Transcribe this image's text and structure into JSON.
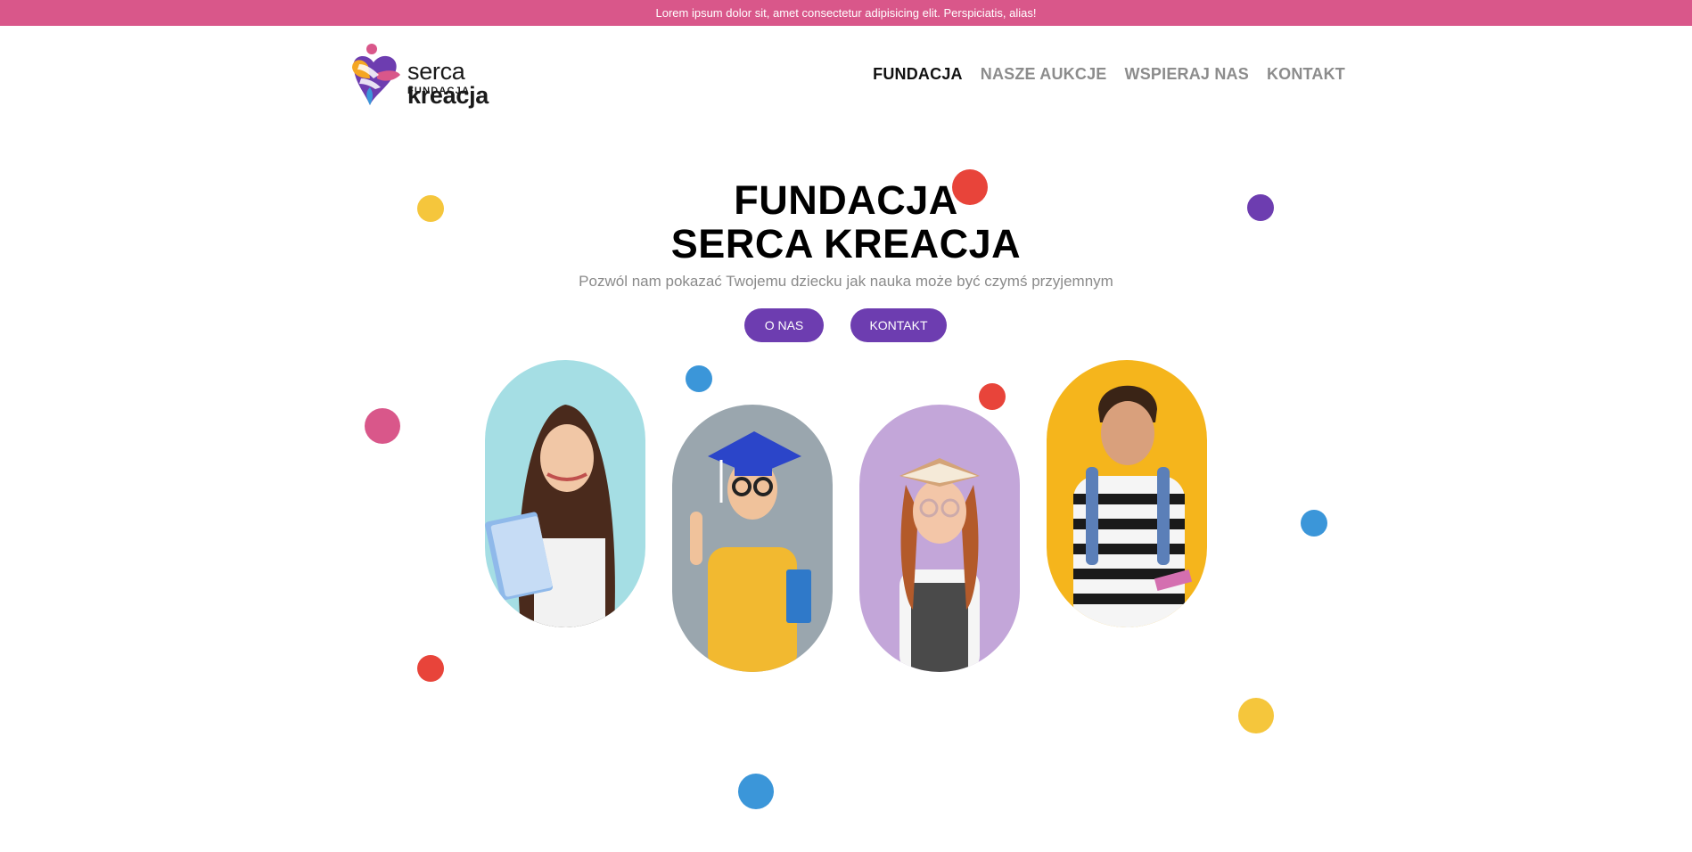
{
  "topbar": {
    "text": "Lorem ipsum dolor sit, amet consectetur adipisicing elit. Perspiciatis, alias!"
  },
  "logo": {
    "name_light": "serca ",
    "name_bold": "kreacja",
    "subtitle": "FUNDACJA"
  },
  "nav": {
    "items": [
      {
        "label": "FUNDACJA",
        "active": true
      },
      {
        "label": "NASZE AUKCJE",
        "active": false
      },
      {
        "label": "WSPIERAJ NAS",
        "active": false
      },
      {
        "label": "KONTAKT",
        "active": false
      }
    ]
  },
  "hero": {
    "title_line1": "FUNDACJA",
    "title_line2": "SERCA KREACJA",
    "subtitle": "Pozwól nam pokazać Twojemu dziecku jak nauka może być czymś przyjemnym",
    "btn_about": "O NAS",
    "btn_contact": "KONTAKT"
  },
  "colors": {
    "topbar": "#d9578a",
    "button": "#6d3db0",
    "dot_yellow": "#f5c63c",
    "dot_red": "#e8443a",
    "dot_purple": "#6d3db0",
    "dot_blue": "#3b96d9",
    "dot_pink": "#d9578a"
  },
  "cards": [
    {
      "subject": "girl-with-notebooks-photo",
      "bg": "#a5dee4"
    },
    {
      "subject": "boy-in-graduation-cap-photo",
      "bg": "#9aa6ae"
    },
    {
      "subject": "girl-with-book-on-head-photo",
      "bg": "#c3a6d9"
    },
    {
      "subject": "boy-with-backpack-photo",
      "bg": "#f5b51c"
    }
  ]
}
